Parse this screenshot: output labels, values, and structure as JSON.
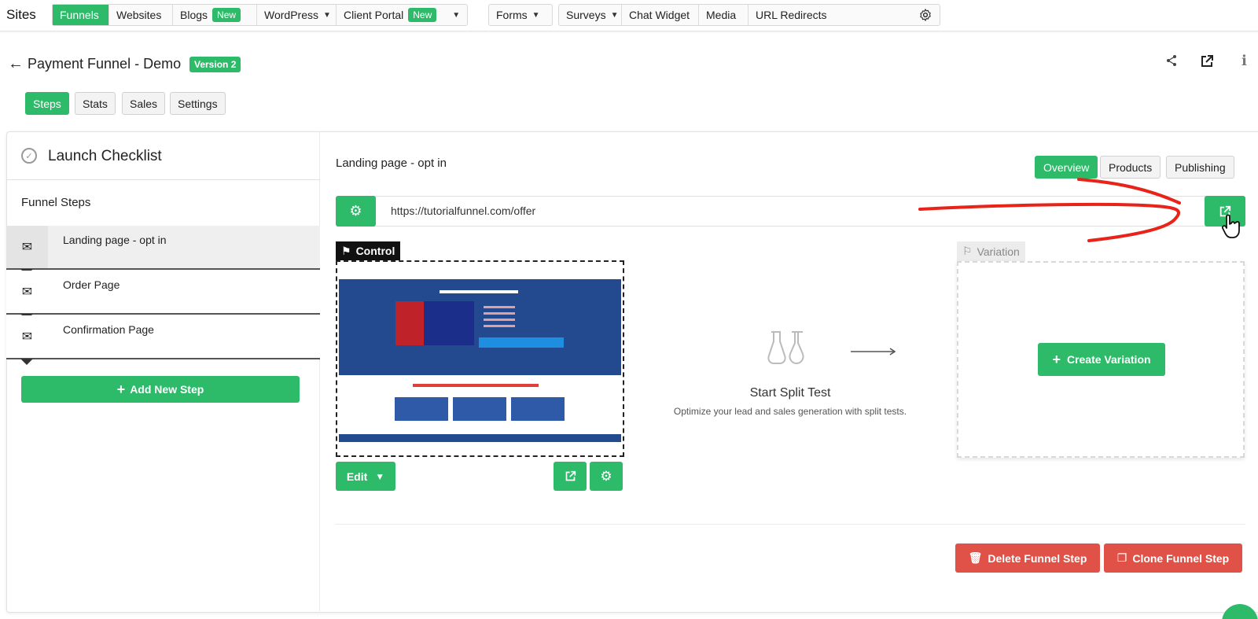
{
  "topnav": {
    "sites_label": "Sites",
    "group1": [
      {
        "label": "Funnels",
        "active": true
      },
      {
        "label": "Websites"
      },
      {
        "label": "Blogs",
        "badge": "New"
      },
      {
        "label": "WordPress",
        "chevron": true
      },
      {
        "label": "Client Portal",
        "badge": "New",
        "chevron": true
      }
    ],
    "forms_label": "Forms",
    "group3": [
      {
        "label": "Surveys",
        "chevron": true
      },
      {
        "label": "Chat Widget"
      },
      {
        "label": "Media"
      },
      {
        "label": "URL Redirects"
      }
    ],
    "settings_icon": "gear-icon"
  },
  "header": {
    "title": "Payment Funnel - Demo",
    "version_badge": "Version 2",
    "back_icon": "back-arrow-icon",
    "actions": [
      "share-icon",
      "external-link-icon",
      "info-icon"
    ]
  },
  "tabs": [
    "Steps",
    "Stats",
    "Sales",
    "Settings"
  ],
  "active_tab": "Steps",
  "sidebar": {
    "checklist_title": "Launch Checklist",
    "funnel_steps_label": "Funnel Steps",
    "steps": [
      {
        "label": "Landing page - opt in",
        "selected": true
      },
      {
        "label": "Order Page"
      },
      {
        "label": "Confirmation Page"
      }
    ],
    "add_step_label": "Add New Step"
  },
  "step": {
    "title": "Landing page - opt in",
    "view_tabs": [
      "Overview",
      "Products",
      "Publishing"
    ],
    "active_view_tab": "Overview",
    "url": "https://tutorialfunnel.com/offer",
    "control_label": "Control",
    "edit_label": "Edit",
    "split_test_title": "Start Split Test",
    "split_test_sub": "Optimize your lead and sales generation with split tests.",
    "variation_label": "Variation",
    "create_variation_label": "Create Variation",
    "delete_label": "Delete Funnel Step",
    "clone_label": "Clone Funnel Step"
  },
  "colors": {
    "accent": "#2dbb6a",
    "danger": "#e05248",
    "annotation": "#e8231a"
  }
}
